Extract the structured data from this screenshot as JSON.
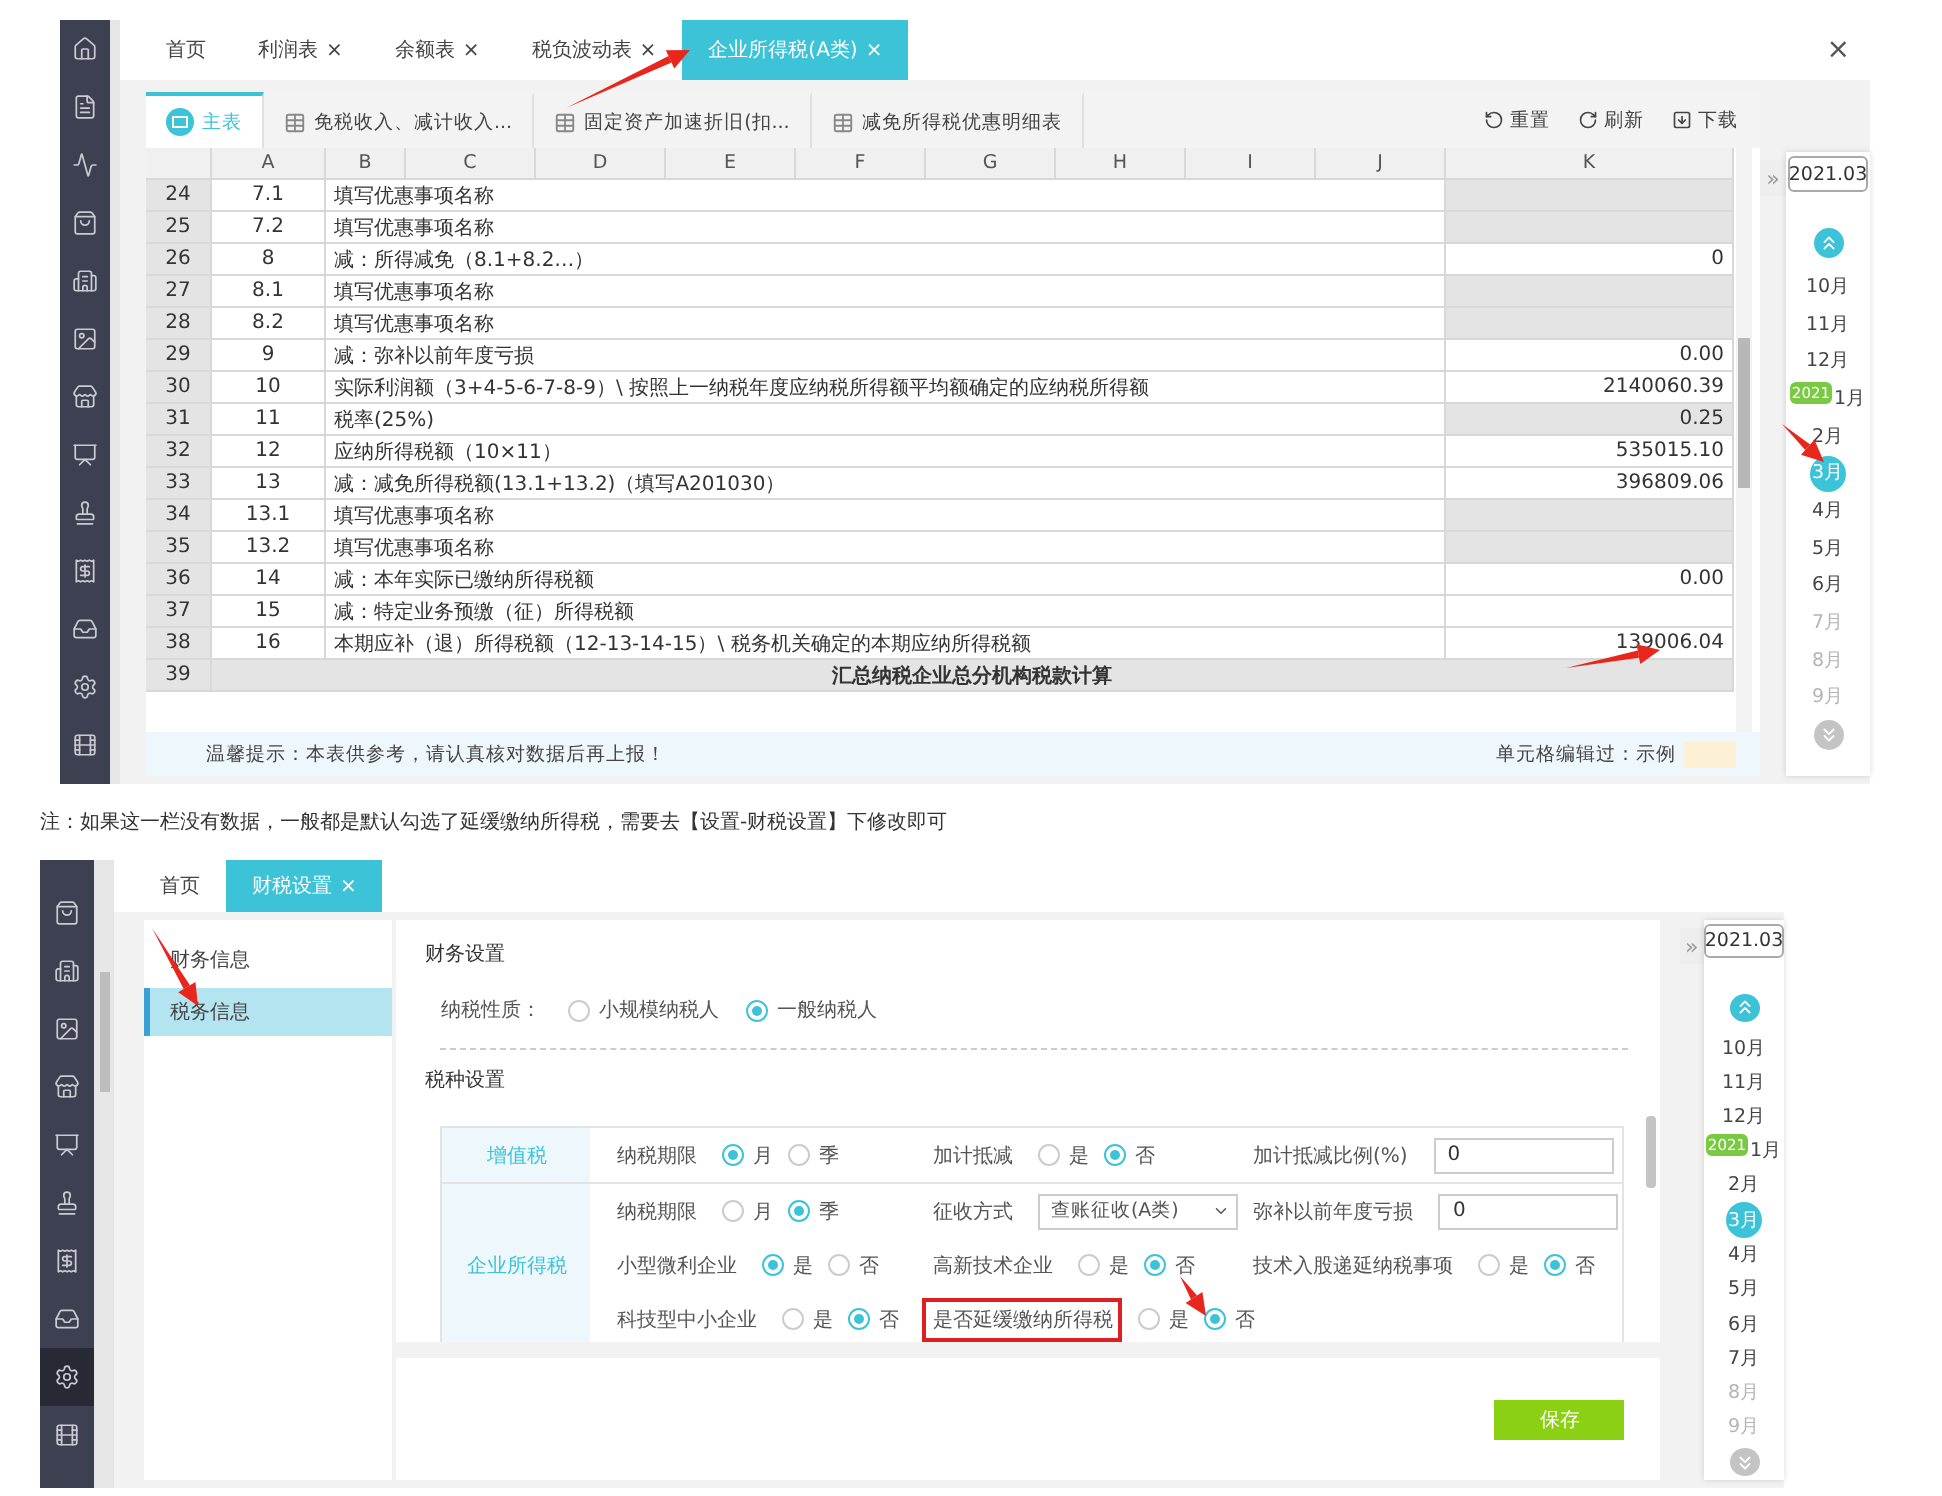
{
  "top_screen": {
    "sidebar": {
      "items": [
        {
          "selected": false
        },
        {
          "selected": false
        },
        {
          "selected": false
        },
        {
          "selected": false
        },
        {
          "selected": false
        },
        {
          "selected": false
        },
        {
          "selected": false
        },
        {
          "selected": false
        },
        {
          "selected": false
        },
        {
          "selected": false
        },
        {
          "selected": false
        },
        {
          "selected": false
        },
        {
          "selected": false
        }
      ]
    },
    "tabs": [
      {
        "label": "首页",
        "selected": false
      },
      {
        "label": "利润表",
        "close": "×",
        "selected": false
      },
      {
        "label": "余额表",
        "close": "×",
        "selected": false
      },
      {
        "label": "税负波动表",
        "close": "×",
        "selected": false
      },
      {
        "label": "企业所得税(A类)",
        "close": "×",
        "selected": true
      }
    ],
    "close_button": "×",
    "sheet_tabs": [
      {
        "label": "主表",
        "selected": true
      },
      {
        "label": "免税收入、减计收入...",
        "selected": false
      },
      {
        "label": "固定资产加速折旧(扣...",
        "selected": false
      },
      {
        "label": "减免所得税优惠明细表",
        "selected": false
      }
    ],
    "toolbar": [
      {
        "label": "重置"
      },
      {
        "label": "刷新"
      },
      {
        "label": "下载"
      }
    ],
    "table": {
      "columns": [
        "A",
        "B",
        "C",
        "D",
        "E",
        "F",
        "G",
        "H",
        "I",
        "J",
        "K"
      ],
      "rows": [
        {
          "kind": "item",
          "number": "24",
          "code": "7.1",
          "item": "填写优惠事项名称",
          "editable": false
        },
        {
          "kind": "item",
          "number": "25",
          "code": "7.2",
          "item": "填写优惠事项名称",
          "editable": false
        },
        {
          "kind": "item",
          "number": "26",
          "code": "8",
          "item": "减：所得减免（8.1+8.2…）",
          "value": "0",
          "editable": true
        },
        {
          "kind": "item",
          "number": "27",
          "code": "8.1",
          "item": "填写优惠事项名称",
          "editable": false
        },
        {
          "kind": "item",
          "number": "28",
          "code": "8.2",
          "item": "填写优惠事项名称",
          "editable": false
        },
        {
          "kind": "item",
          "number": "29",
          "code": "9",
          "item": "减：弥补以前年度亏损",
          "value": "0.00",
          "editable": true
        },
        {
          "kind": "item",
          "number": "30",
          "code": "10",
          "item": "实际利润额（3+4-5-6-7-8-9）\\ 按照上一纳税年度应纳税所得额平均额确定的应纳税所得额",
          "value": "2140060.39",
          "editable": true
        },
        {
          "kind": "item",
          "number": "31",
          "code": "11",
          "item": "税率(25%)",
          "value": "0.25",
          "editable": false
        },
        {
          "kind": "item",
          "number": "32",
          "code": "12",
          "item": "应纳所得税额（10×11）",
          "value": "535015.10",
          "editable": true
        },
        {
          "kind": "item",
          "number": "33",
          "code": "13",
          "item": "减：减免所得税额(13.1+13.2)（填写A201030）",
          "value": "396809.06",
          "editable": true
        },
        {
          "kind": "item",
          "number": "34",
          "code": "13.1",
          "item": "填写优惠事项名称",
          "editable": false
        },
        {
          "kind": "item",
          "number": "35",
          "code": "13.2",
          "item": "填写优惠事项名称",
          "editable": false
        },
        {
          "kind": "item",
          "number": "36",
          "code": "14",
          "item": "减：本年实际已缴纳所得税额",
          "value": "0.00",
          "editable": true
        },
        {
          "kind": "item",
          "number": "37",
          "code": "15",
          "item": "减：特定业务预缴（征）所得税额",
          "editable": true
        },
        {
          "kind": "item",
          "number": "38",
          "code": "16",
          "item": "本期应补（退）所得税额（12-13-14-15）\\ 税务机关确定的本期应纳所得税额",
          "value": "139006.04",
          "editable": true
        },
        {
          "kind": "section",
          "number": "39",
          "item": "汇总纳税企业总分机构税款计算"
        }
      ]
    },
    "notice": "温馨提示：本表供参考，请认真核对数据后再上报！",
    "legend": {
      "label": "单元格编辑过：示例"
    },
    "month_panel": {
      "toggle": "»",
      "year_field": "2021.03",
      "months": [
        {
          "label": "10月",
          "selected": false,
          "disabled": false
        },
        {
          "label": "11月",
          "selected": false,
          "disabled": false
        },
        {
          "label": "12月",
          "selected": false,
          "disabled": false
        },
        {
          "label": "1月",
          "badge": "2021",
          "selected": false,
          "disabled": false
        },
        {
          "label": "2月",
          "selected": false,
          "disabled": false
        },
        {
          "label": "3月",
          "selected": true,
          "disabled": false
        },
        {
          "label": "4月",
          "selected": false,
          "disabled": false
        },
        {
          "label": "5月",
          "selected": false,
          "disabled": false
        },
        {
          "label": "6月",
          "selected": false,
          "disabled": false
        },
        {
          "label": "7月",
          "selected": false,
          "disabled": true
        },
        {
          "label": "8月",
          "selected": false,
          "disabled": true
        },
        {
          "label": "9月",
          "selected": false,
          "disabled": true
        }
      ]
    }
  },
  "note": "注：如果这一栏没有数据，一般都是默认勾选了延缓缴纳所得税，需要去【设置-财税设置】下修改即可",
  "bottom_screen": {
    "sidebar": {
      "items": [
        {
          "selected": false
        },
        {
          "selected": false
        },
        {
          "selected": false
        },
        {
          "selected": false
        },
        {
          "selected": false
        },
        {
          "selected": false
        },
        {
          "selected": false
        },
        {
          "selected": false
        },
        {
          "selected": true
        },
        {
          "selected": false
        }
      ]
    },
    "tabs": [
      {
        "label": "首页",
        "selected": false
      },
      {
        "label": "财税设置",
        "close": "×",
        "selected": true
      }
    ],
    "nav": [
      {
        "label": "财务信息",
        "selected": false
      },
      {
        "label": "税务信息",
        "selected": true
      }
    ],
    "finance_heading": "财务设置",
    "taxpayer_type": {
      "label": "纳税性质：",
      "options": [
        {
          "label": "小规模纳税人",
          "selected": false
        },
        {
          "label": "一般纳税人",
          "selected": true
        }
      ]
    },
    "tax_heading": "税种设置",
    "tax_groups": [
      {
        "name": "增值税",
        "rows": [
          {
            "fields": [
              {
                "kind": "radio",
                "label": "纳税期限",
                "highlighted": false,
                "options": [
                  {
                    "label": "月",
                    "selected": true
                  },
                  {
                    "label": "季",
                    "selected": false
                  }
                ]
              },
              {
                "kind": "radio",
                "label": "加计抵减",
                "highlighted": false,
                "options": [
                  {
                    "label": "是",
                    "selected": false
                  },
                  {
                    "label": "否",
                    "selected": true
                  }
                ]
              },
              {
                "kind": "input",
                "label": "加计抵减比例(%)",
                "highlighted": false,
                "value": "0"
              }
            ]
          }
        ]
      },
      {
        "name": "企业所得税",
        "rows": [
          {
            "fields": [
              {
                "kind": "radio",
                "label": "纳税期限",
                "highlighted": false,
                "options": [
                  {
                    "label": "月",
                    "selected": false
                  },
                  {
                    "label": "季",
                    "selected": true
                  }
                ]
              },
              {
                "kind": "select",
                "label": "征收方式",
                "highlighted": false,
                "value": "查账征收(A类)"
              },
              {
                "kind": "input",
                "label": "弥补以前年度亏损",
                "highlighted": false,
                "value": "0"
              }
            ]
          },
          {
            "fields": [
              {
                "kind": "radio",
                "label": "小型微利企业",
                "highlighted": false,
                "options": [
                  {
                    "label": "是",
                    "selected": true
                  },
                  {
                    "label": "否",
                    "selected": false
                  }
                ]
              },
              {
                "kind": "radio",
                "label": "高新技术企业",
                "highlighted": false,
                "options": [
                  {
                    "label": "是",
                    "selected": false
                  },
                  {
                    "label": "否",
                    "selected": true
                  }
                ]
              },
              {
                "kind": "radio",
                "label": "技术入股递延纳税事项",
                "highlighted": false,
                "options": [
                  {
                    "label": "是",
                    "selected": false
                  },
                  {
                    "label": "否",
                    "selected": true
                  }
                ]
              }
            ]
          },
          {
            "fields": [
              {
                "kind": "radio",
                "label": "科技型中小企业",
                "highlighted": false,
                "options": [
                  {
                    "label": "是",
                    "selected": false
                  },
                  {
                    "label": "否",
                    "selected": true
                  }
                ]
              },
              {
                "kind": "radio",
                "label": "是否延缓缴纳所得税",
                "highlighted": true,
                "options": [
                  {
                    "label": "是",
                    "selected": false
                  },
                  {
                    "label": "否",
                    "selected": true
                  }
                ]
              }
            ]
          }
        ]
      }
    ],
    "save_button": "保存",
    "month_panel": {
      "toggle": "»",
      "year_field": "2021.03",
      "months": [
        {
          "label": "10月",
          "selected": false,
          "disabled": false
        },
        {
          "label": "11月",
          "selected": false,
          "disabled": false
        },
        {
          "label": "12月",
          "selected": false,
          "disabled": false
        },
        {
          "label": "1月",
          "badge": "2021",
          "selected": false,
          "disabled": false
        },
        {
          "label": "2月",
          "selected": false,
          "disabled": false
        },
        {
          "label": "3月",
          "selected": true,
          "disabled": false
        },
        {
          "label": "4月",
          "selected": false,
          "disabled": false
        },
        {
          "label": "5月",
          "selected": false,
          "disabled": false
        },
        {
          "label": "6月",
          "selected": false,
          "disabled": false
        },
        {
          "label": "7月",
          "selected": false,
          "disabled": false
        },
        {
          "label": "8月",
          "selected": false,
          "disabled": true
        },
        {
          "label": "9月",
          "selected": false,
          "disabled": true
        }
      ]
    }
  }
}
